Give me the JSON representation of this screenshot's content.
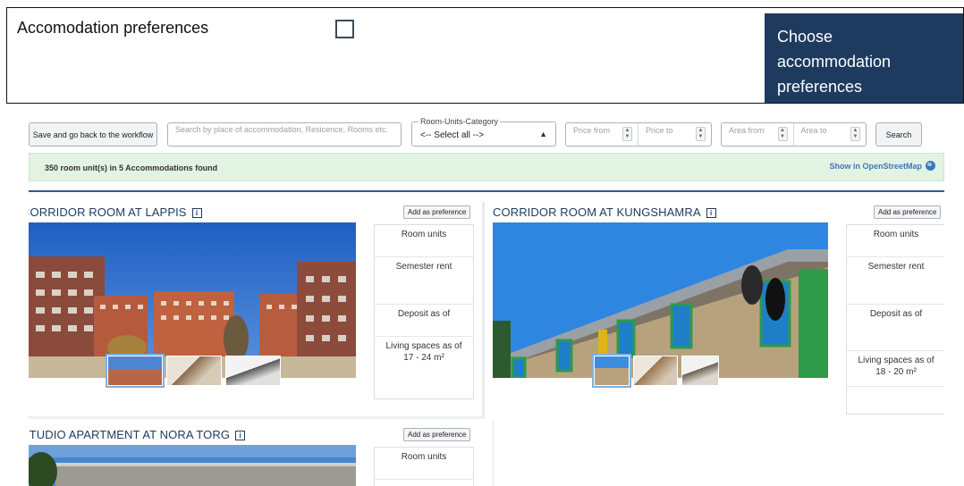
{
  "preference": {
    "label": "Accomodation preferences",
    "cta": "Choose accommodation preferences"
  },
  "toolbar": {
    "back_label": "Save and go back to the workflow",
    "search_placeholder": "Search by place of accommodation, Resicence, Rooms etc.",
    "category_legend": "Room-Units-Category",
    "category_value": "<-- Select all -->",
    "price_from": "Price from",
    "price_to": "Price to",
    "area_from": "Area from",
    "area_to": "Area to",
    "search_label": "Search"
  },
  "results": {
    "summary": "350 room unit(s) in 5 Accommodations found",
    "map_link": "Show in OpenStreetMap"
  },
  "cards": [
    {
      "title": "CORRIDOR ROOM AT LAPPIS",
      "add_label": "Add as preference",
      "room_units": "Room units",
      "semester_rent": "Semester rent",
      "deposit": "Deposit as of",
      "living_spaces": "Living spaces as of",
      "living_range": "17 - 24 m²"
    },
    {
      "title": "CORRIDOR ROOM AT KUNGSHAMRA",
      "add_label": "Add as preference",
      "room_units": "Room units",
      "semester_rent": "Semester rent",
      "deposit": "Deposit as of",
      "living_spaces": "Living spaces as of",
      "living_range": "18 - 20 m²"
    },
    {
      "title": "STUDIO APARTMENT AT NORA TORG",
      "add_label": "Add as preference",
      "room_units": "Room units"
    }
  ],
  "colors": {
    "accent": "#1e3a5f",
    "banner": "#e3f3e3",
    "link": "#3a78b8"
  }
}
